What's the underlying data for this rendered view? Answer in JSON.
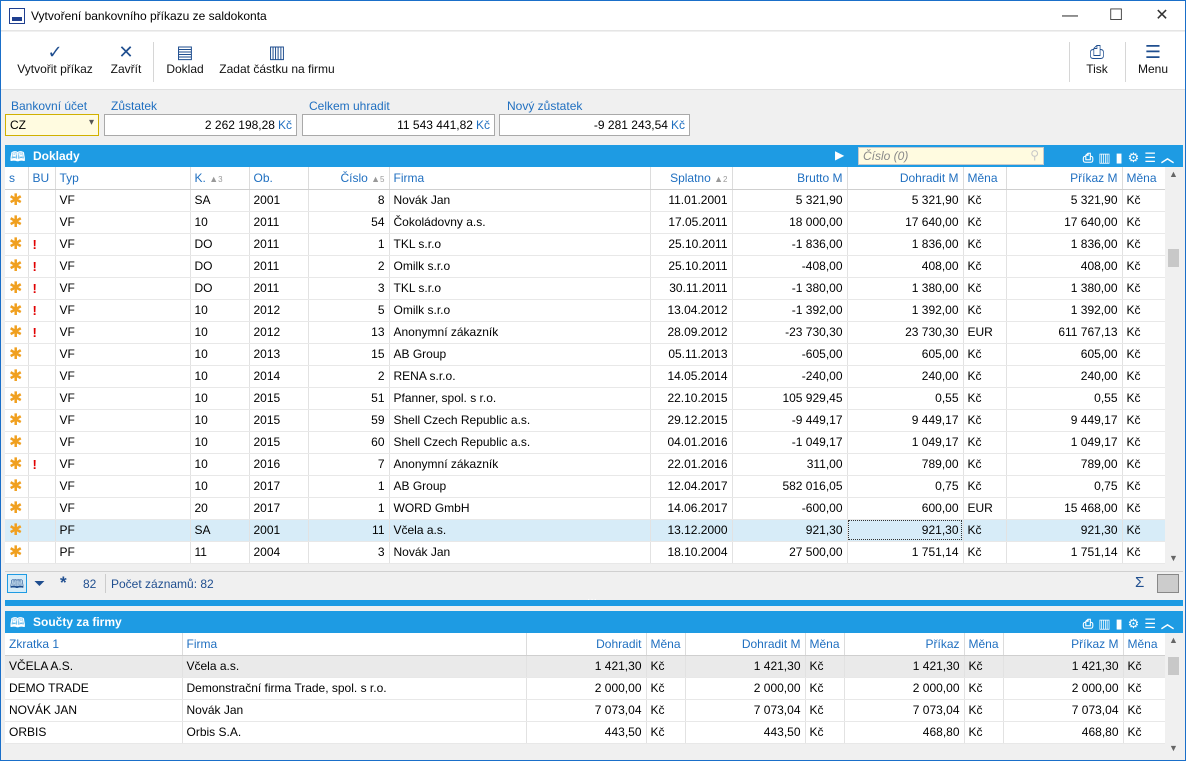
{
  "window": {
    "title": "Vytvoření bankovního příkazu ze saldokonta"
  },
  "toolbar": {
    "create_label": "Vytvořit příkaz",
    "close_label": "Zavřít",
    "doc_label": "Doklad",
    "amount_label": "Zadat částku na firmu",
    "print_label": "Tisk",
    "menu_label": "Menu"
  },
  "fields": {
    "account_label": "Bankovní účet",
    "account_value": "CZ",
    "balance_label": "Zůstatek",
    "balance_value": "2 262 198,28",
    "total_label": "Celkem uhradit",
    "total_value": "11 543 441,82",
    "new_balance_label": "Nový zůstatek",
    "new_balance_value": "-9 281 243,54",
    "currency": "Kč"
  },
  "doklady": {
    "title": "Doklady",
    "search_placeholder": "Číslo (0)",
    "columns": [
      "s",
      "BU",
      "Typ",
      "K.",
      "Ob.",
      "Číslo",
      "Firma",
      "Splatno",
      "Brutto M",
      "Dohradit M",
      "Měna",
      "Příkaz M",
      "Měna"
    ],
    "sort_k": "3",
    "sort_cislo": "5",
    "sort_splatno": "2",
    "rows": [
      {
        "bu": "",
        "typ": "VF",
        "k": "SA",
        "ob": "2001",
        "cislo": "8",
        "firma": "Novák Jan",
        "splatno": "11.01.2001",
        "brutto": "5 321,90",
        "dohradit": "5 321,90",
        "mena": "Kč",
        "prikaz": "5 321,90",
        "mena2": "Kč"
      },
      {
        "bu": "",
        "typ": "VF",
        "k": "10",
        "ob": "2011",
        "cislo": "54",
        "firma": "Čokoládovny a.s.",
        "splatno": "17.05.2011",
        "brutto": "18 000,00",
        "dohradit": "17 640,00",
        "mena": "Kč",
        "prikaz": "17 640,00",
        "mena2": "Kč"
      },
      {
        "bu": "!",
        "typ": "VF",
        "k": "DO",
        "ob": "2011",
        "cislo": "1",
        "firma": "TKL s.r.o",
        "splatno": "25.10.2011",
        "brutto": "-1 836,00",
        "dohradit": "1 836,00",
        "mena": "Kč",
        "prikaz": "1 836,00",
        "mena2": "Kč"
      },
      {
        "bu": "!",
        "typ": "VF",
        "k": "DO",
        "ob": "2011",
        "cislo": "2",
        "firma": "Omilk s.r.o",
        "splatno": "25.10.2011",
        "brutto": "-408,00",
        "dohradit": "408,00",
        "mena": "Kč",
        "prikaz": "408,00",
        "mena2": "Kč"
      },
      {
        "bu": "!",
        "typ": "VF",
        "k": "DO",
        "ob": "2011",
        "cislo": "3",
        "firma": "TKL s.r.o",
        "splatno": "30.11.2011",
        "brutto": "-1 380,00",
        "dohradit": "1 380,00",
        "mena": "Kč",
        "prikaz": "1 380,00",
        "mena2": "Kč"
      },
      {
        "bu": "!",
        "typ": "VF",
        "k": "10",
        "ob": "2012",
        "cislo": "5",
        "firma": "Omilk s.r.o",
        "splatno": "13.04.2012",
        "brutto": "-1 392,00",
        "dohradit": "1 392,00",
        "mena": "Kč",
        "prikaz": "1 392,00",
        "mena2": "Kč"
      },
      {
        "bu": "!",
        "typ": "VF",
        "k": "10",
        "ob": "2012",
        "cislo": "13",
        "firma": "Anonymní zákazník",
        "splatno": "28.09.2012",
        "brutto": "-23 730,30",
        "dohradit": "23 730,30",
        "mena": "EUR",
        "prikaz": "611 767,13",
        "mena2": "Kč"
      },
      {
        "bu": "",
        "typ": "VF",
        "k": "10",
        "ob": "2013",
        "cislo": "15",
        "firma": "AB Group",
        "splatno": "05.11.2013",
        "brutto": "-605,00",
        "dohradit": "605,00",
        "mena": "Kč",
        "prikaz": "605,00",
        "mena2": "Kč"
      },
      {
        "bu": "",
        "typ": "VF",
        "k": "10",
        "ob": "2014",
        "cislo": "2",
        "firma": "RENA s.r.o.",
        "splatno": "14.05.2014",
        "brutto": "-240,00",
        "dohradit": "240,00",
        "mena": "Kč",
        "prikaz": "240,00",
        "mena2": "Kč"
      },
      {
        "bu": "",
        "typ": "VF",
        "k": "10",
        "ob": "2015",
        "cislo": "51",
        "firma": "Pfanner, spol. s r.o.",
        "splatno": "22.10.2015",
        "brutto": "105 929,45",
        "dohradit": "0,55",
        "mena": "Kč",
        "prikaz": "0,55",
        "mena2": "Kč"
      },
      {
        "bu": "",
        "typ": "VF",
        "k": "10",
        "ob": "2015",
        "cislo": "59",
        "firma": "Shell Czech Republic a.s.",
        "splatno": "29.12.2015",
        "brutto": "-9 449,17",
        "dohradit": "9 449,17",
        "mena": "Kč",
        "prikaz": "9 449,17",
        "mena2": "Kč"
      },
      {
        "bu": "",
        "typ": "VF",
        "k": "10",
        "ob": "2015",
        "cislo": "60",
        "firma": "Shell Czech Republic a.s.",
        "splatno": "04.01.2016",
        "brutto": "-1 049,17",
        "dohradit": "1 049,17",
        "mena": "Kč",
        "prikaz": "1 049,17",
        "mena2": "Kč"
      },
      {
        "bu": "!",
        "typ": "VF",
        "k": "10",
        "ob": "2016",
        "cislo": "7",
        "firma": "Anonymní zákazník",
        "splatno": "22.01.2016",
        "brutto": "311,00",
        "dohradit": "789,00",
        "mena": "Kč",
        "prikaz": "789,00",
        "mena2": "Kč"
      },
      {
        "bu": "",
        "typ": "VF",
        "k": "10",
        "ob": "2017",
        "cislo": "1",
        "firma": "AB Group",
        "splatno": "12.04.2017",
        "brutto": "582 016,05",
        "dohradit": "0,75",
        "mena": "Kč",
        "prikaz": "0,75",
        "mena2": "Kč"
      },
      {
        "bu": "",
        "typ": "VF",
        "k": "20",
        "ob": "2017",
        "cislo": "1",
        "firma": "WORD GmbH",
        "splatno": "14.06.2017",
        "brutto": "-600,00",
        "dohradit": "600,00",
        "mena": "EUR",
        "prikaz": "15 468,00",
        "mena2": "Kč"
      },
      {
        "bu": "",
        "typ": "PF",
        "k": "SA",
        "ob": "2001",
        "cislo": "11",
        "firma": "Včela a.s.",
        "splatno": "13.12.2000",
        "brutto": "921,30",
        "dohradit": "921,30",
        "mena": "Kč",
        "prikaz": "921,30",
        "mena2": "Kč"
      },
      {
        "bu": "",
        "typ": "PF",
        "k": "11",
        "ob": "2004",
        "cislo": "3",
        "firma": "Novák Jan",
        "splatno": "18.10.2004",
        "brutto": "27 500,00",
        "dohradit": "1 751,14",
        "mena": "Kč",
        "prikaz": "1 751,14",
        "mena2": "Kč"
      }
    ],
    "marked_count": "82",
    "record_count_label": "Počet záznamů: 82"
  },
  "soucty": {
    "title": "Součty za firmy",
    "columns": [
      "Zkratka 1",
      "Firma",
      "Dohradit",
      "Měna",
      "Dohradit M",
      "Měna",
      "Příkaz",
      "Měna",
      "Příkaz M",
      "Měna"
    ],
    "rows": [
      {
        "zkratka": "VČELA A.S.",
        "firma": "Včela a.s.",
        "dohradit": "1 421,30",
        "mena1": "Kč",
        "dohraditm": "1 421,30",
        "mena2": "Kč",
        "prikaz": "1 421,30",
        "mena3": "Kč",
        "prikazm": "1 421,30",
        "mena4": "Kč"
      },
      {
        "zkratka": "DEMO TRADE",
        "firma": "Demonstrační firma Trade, spol. s r.o.",
        "dohradit": "2 000,00",
        "mena1": "Kč",
        "dohraditm": "2 000,00",
        "mena2": "Kč",
        "prikaz": "2 000,00",
        "mena3": "Kč",
        "prikazm": "2 000,00",
        "mena4": "Kč"
      },
      {
        "zkratka": "NOVÁK JAN",
        "firma": "Novák Jan",
        "dohradit": "7 073,04",
        "mena1": "Kč",
        "dohraditm": "7 073,04",
        "mena2": "Kč",
        "prikaz": "7 073,04",
        "mena3": "Kč",
        "prikazm": "7 073,04",
        "mena4": "Kč"
      },
      {
        "zkratka": "ORBIS",
        "firma": "Orbis S.A.",
        "dohradit": "443,50",
        "mena1": "Kč",
        "dohraditm": "443,50",
        "mena2": "Kč",
        "prikaz": "468,80",
        "mena3": "Kč",
        "prikazm": "468,80",
        "mena4": "Kč"
      }
    ]
  },
  "colors": {
    "accent": "#1e9be3",
    "marker": "#f0a020",
    "alert": "#e00000",
    "label": "#1f6fc0"
  }
}
